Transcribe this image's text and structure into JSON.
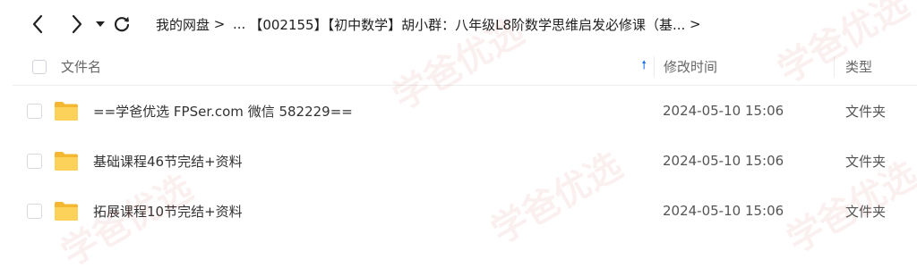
{
  "toolbar": {
    "back_icon": "chevron-left-icon",
    "forward_icon": "chevron-right-icon",
    "dropdown_icon": "caret-down-icon",
    "refresh_icon": "refresh-icon"
  },
  "breadcrumb": {
    "root": "我的网盘",
    "ellipsis": "...",
    "current": "【002155】【初中数学】胡小群：八年级L8阶数学思维启发必修课（基...",
    "separator": ">"
  },
  "table": {
    "columns": {
      "name": "文件名",
      "modified": "修改时间",
      "type": "类型"
    },
    "sort_icon": "arrow-up-icon",
    "rows": [
      {
        "name": "==学爸优选 FPSer.com 微信 582229==",
        "modified": "2024-05-10 15:06",
        "type": "文件夹"
      },
      {
        "name": "基础课程46节完结+资料",
        "modified": "2024-05-10 15:06",
        "type": "文件夹"
      },
      {
        "name": "拓展课程10节完结+资料",
        "modified": "2024-05-10 15:06",
        "type": "文件夹"
      }
    ]
  },
  "colors": {
    "accent": "#1a73e8",
    "folder": "#f7c744"
  },
  "watermark": {
    "text": "学爸优选"
  }
}
